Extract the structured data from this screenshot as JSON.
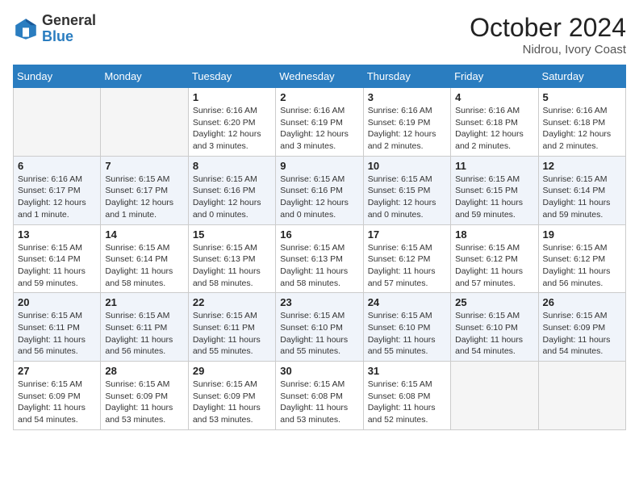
{
  "header": {
    "logo_general": "General",
    "logo_blue": "Blue",
    "month_title": "October 2024",
    "location": "Nidrou, Ivory Coast"
  },
  "weekdays": [
    "Sunday",
    "Monday",
    "Tuesday",
    "Wednesday",
    "Thursday",
    "Friday",
    "Saturday"
  ],
  "weeks": [
    [
      {
        "day": "",
        "info": ""
      },
      {
        "day": "",
        "info": ""
      },
      {
        "day": "1",
        "info": "Sunrise: 6:16 AM\nSunset: 6:20 PM\nDaylight: 12 hours and 3 minutes."
      },
      {
        "day": "2",
        "info": "Sunrise: 6:16 AM\nSunset: 6:19 PM\nDaylight: 12 hours and 3 minutes."
      },
      {
        "day": "3",
        "info": "Sunrise: 6:16 AM\nSunset: 6:19 PM\nDaylight: 12 hours and 2 minutes."
      },
      {
        "day": "4",
        "info": "Sunrise: 6:16 AM\nSunset: 6:18 PM\nDaylight: 12 hours and 2 minutes."
      },
      {
        "day": "5",
        "info": "Sunrise: 6:16 AM\nSunset: 6:18 PM\nDaylight: 12 hours and 2 minutes."
      }
    ],
    [
      {
        "day": "6",
        "info": "Sunrise: 6:16 AM\nSunset: 6:17 PM\nDaylight: 12 hours and 1 minute."
      },
      {
        "day": "7",
        "info": "Sunrise: 6:15 AM\nSunset: 6:17 PM\nDaylight: 12 hours and 1 minute."
      },
      {
        "day": "8",
        "info": "Sunrise: 6:15 AM\nSunset: 6:16 PM\nDaylight: 12 hours and 0 minutes."
      },
      {
        "day": "9",
        "info": "Sunrise: 6:15 AM\nSunset: 6:16 PM\nDaylight: 12 hours and 0 minutes."
      },
      {
        "day": "10",
        "info": "Sunrise: 6:15 AM\nSunset: 6:15 PM\nDaylight: 12 hours and 0 minutes."
      },
      {
        "day": "11",
        "info": "Sunrise: 6:15 AM\nSunset: 6:15 PM\nDaylight: 11 hours and 59 minutes."
      },
      {
        "day": "12",
        "info": "Sunrise: 6:15 AM\nSunset: 6:14 PM\nDaylight: 11 hours and 59 minutes."
      }
    ],
    [
      {
        "day": "13",
        "info": "Sunrise: 6:15 AM\nSunset: 6:14 PM\nDaylight: 11 hours and 59 minutes."
      },
      {
        "day": "14",
        "info": "Sunrise: 6:15 AM\nSunset: 6:14 PM\nDaylight: 11 hours and 58 minutes."
      },
      {
        "day": "15",
        "info": "Sunrise: 6:15 AM\nSunset: 6:13 PM\nDaylight: 11 hours and 58 minutes."
      },
      {
        "day": "16",
        "info": "Sunrise: 6:15 AM\nSunset: 6:13 PM\nDaylight: 11 hours and 58 minutes."
      },
      {
        "day": "17",
        "info": "Sunrise: 6:15 AM\nSunset: 6:12 PM\nDaylight: 11 hours and 57 minutes."
      },
      {
        "day": "18",
        "info": "Sunrise: 6:15 AM\nSunset: 6:12 PM\nDaylight: 11 hours and 57 minutes."
      },
      {
        "day": "19",
        "info": "Sunrise: 6:15 AM\nSunset: 6:12 PM\nDaylight: 11 hours and 56 minutes."
      }
    ],
    [
      {
        "day": "20",
        "info": "Sunrise: 6:15 AM\nSunset: 6:11 PM\nDaylight: 11 hours and 56 minutes."
      },
      {
        "day": "21",
        "info": "Sunrise: 6:15 AM\nSunset: 6:11 PM\nDaylight: 11 hours and 56 minutes."
      },
      {
        "day": "22",
        "info": "Sunrise: 6:15 AM\nSunset: 6:11 PM\nDaylight: 11 hours and 55 minutes."
      },
      {
        "day": "23",
        "info": "Sunrise: 6:15 AM\nSunset: 6:10 PM\nDaylight: 11 hours and 55 minutes."
      },
      {
        "day": "24",
        "info": "Sunrise: 6:15 AM\nSunset: 6:10 PM\nDaylight: 11 hours and 55 minutes."
      },
      {
        "day": "25",
        "info": "Sunrise: 6:15 AM\nSunset: 6:10 PM\nDaylight: 11 hours and 54 minutes."
      },
      {
        "day": "26",
        "info": "Sunrise: 6:15 AM\nSunset: 6:09 PM\nDaylight: 11 hours and 54 minutes."
      }
    ],
    [
      {
        "day": "27",
        "info": "Sunrise: 6:15 AM\nSunset: 6:09 PM\nDaylight: 11 hours and 54 minutes."
      },
      {
        "day": "28",
        "info": "Sunrise: 6:15 AM\nSunset: 6:09 PM\nDaylight: 11 hours and 53 minutes."
      },
      {
        "day": "29",
        "info": "Sunrise: 6:15 AM\nSunset: 6:09 PM\nDaylight: 11 hours and 53 minutes."
      },
      {
        "day": "30",
        "info": "Sunrise: 6:15 AM\nSunset: 6:08 PM\nDaylight: 11 hours and 53 minutes."
      },
      {
        "day": "31",
        "info": "Sunrise: 6:15 AM\nSunset: 6:08 PM\nDaylight: 11 hours and 52 minutes."
      },
      {
        "day": "",
        "info": ""
      },
      {
        "day": "",
        "info": ""
      }
    ]
  ]
}
